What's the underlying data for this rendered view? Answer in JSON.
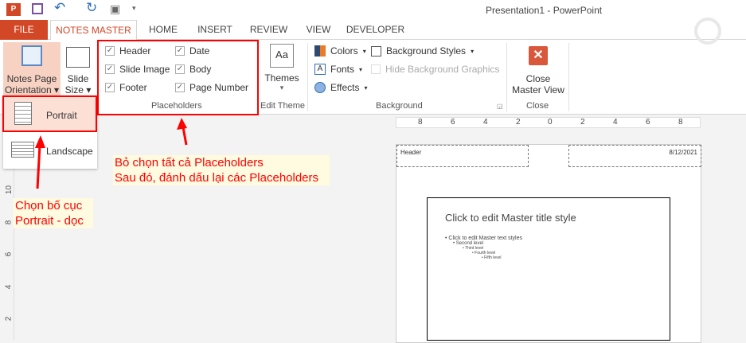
{
  "window": {
    "title": "Presentation1 - PowerPoint"
  },
  "tabs": [
    "FILE",
    "NOTES MASTER",
    "HOME",
    "INSERT",
    "REVIEW",
    "VIEW",
    "DEVELOPER"
  ],
  "ribbon": {
    "page_setup": {
      "orientation_label1": "Notes Page",
      "orientation_label2": "Orientation",
      "slide_size1": "Slide",
      "slide_size2": "Size"
    },
    "placeholders": {
      "label": "Placeholders",
      "items": [
        {
          "label": "Header",
          "checked": true
        },
        {
          "label": "Slide Image",
          "checked": true
        },
        {
          "label": "Footer",
          "checked": true
        },
        {
          "label": "Date",
          "checked": true
        },
        {
          "label": "Body",
          "checked": true
        },
        {
          "label": "Page Number",
          "checked": true
        }
      ]
    },
    "edit_theme": {
      "themes": "Themes",
      "label": "Edit Theme"
    },
    "background": {
      "colors": "Colors",
      "fonts": "Fonts",
      "effects": "Effects",
      "bg_styles": "Background Styles",
      "hide_bg": "Hide Background Graphics",
      "label": "Background"
    },
    "close": {
      "line1": "Close",
      "line2": "Master View",
      "label": "Close"
    }
  },
  "dropdown": {
    "portrait": "Portrait",
    "landscape": "Landscape"
  },
  "ruler": {
    "h_labels": [
      "8",
      "6",
      "4",
      "2",
      "0",
      "2",
      "4",
      "6",
      "8"
    ],
    "v_labels": [
      "10",
      "8",
      "6",
      "4",
      "2"
    ]
  },
  "notes_page": {
    "header": "Header",
    "date": "8/12/2021",
    "slide_title": "Click to edit Master title style",
    "levels": [
      "Click to edit Master text styles",
      "Second level",
      "Third level",
      "Fourth level",
      "Fifth level"
    ]
  },
  "annotations": {
    "placeholders_line1": "Bỏ chọn tất cả Placeholders",
    "placeholders_line2": "Sau đó, đánh dấu lại các Placeholders",
    "portrait_line1": "Chọn bố cục",
    "portrait_line2": "Portrait - dọc"
  },
  "colors": {
    "accent": "#d24726",
    "annotation": "#ff0000"
  }
}
